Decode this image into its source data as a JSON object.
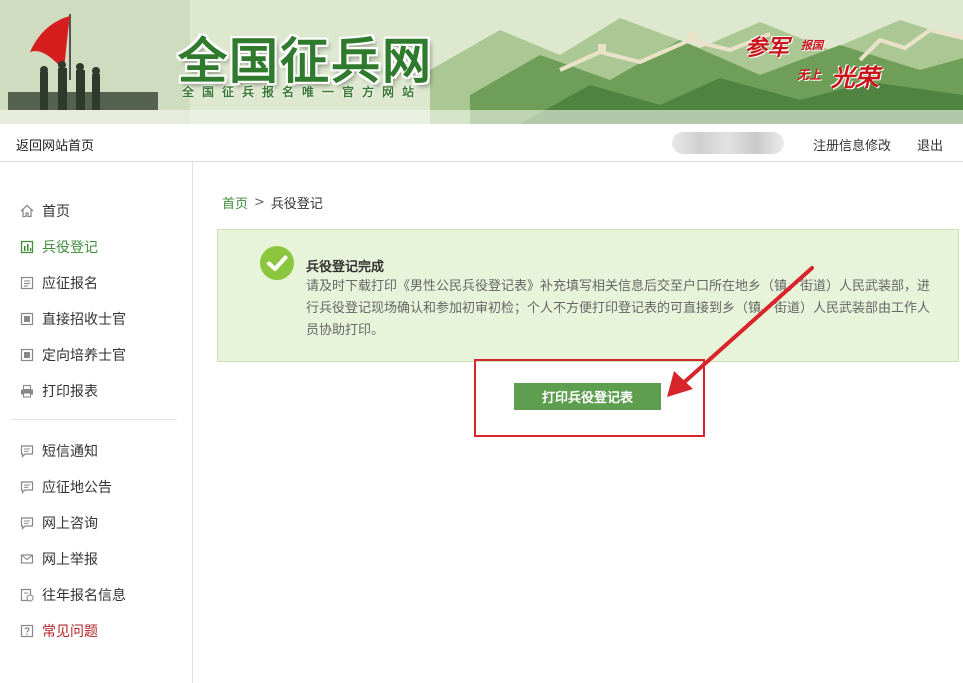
{
  "site": {
    "title": "全国征兵网",
    "subtitle": "全国征兵报名唯一官方网站"
  },
  "slogan": {
    "part1": "参军",
    "part2": "报国",
    "part3": "无上",
    "part4": "光荣"
  },
  "topnav": {
    "home_link": "返回网站首页",
    "profile_link": "注册信息修改",
    "logout_link": "退出"
  },
  "sidebar": {
    "items": [
      {
        "label": "首页",
        "icon": "home-icon"
      },
      {
        "label": "兵役登记",
        "icon": "register-icon",
        "active": true
      },
      {
        "label": "应征报名",
        "icon": "form-icon"
      },
      {
        "label": "直接招收士官",
        "icon": "form-icon"
      },
      {
        "label": "定向培养士官",
        "icon": "form-icon"
      },
      {
        "label": "打印报表",
        "icon": "printer-icon"
      },
      {
        "label": "短信通知",
        "icon": "message-icon"
      },
      {
        "label": "应征地公告",
        "icon": "message-icon"
      },
      {
        "label": "网上咨询",
        "icon": "message-icon"
      },
      {
        "label": "网上举报",
        "icon": "mail-icon"
      },
      {
        "label": "往年报名信息",
        "icon": "history-icon"
      },
      {
        "label": "常见问题",
        "icon": "question-icon"
      }
    ]
  },
  "breadcrumb": {
    "home": "首页",
    "separator": ">",
    "current": "兵役登记"
  },
  "notice": {
    "title": "兵役登记完成",
    "description": "请及时下载打印《男性公民兵役登记表》补充填写相关信息后交至户口所在地乡（镇、街道）人民武装部，进行兵役登记现场确认和参加初审初检；个人不方便打印登记表的可直接到乡（镇、街道）人民武装部由工作人员协助打印。"
  },
  "actions": {
    "print_button": "打印兵役登记表"
  },
  "colors": {
    "accent_green": "#3f8f3a",
    "button_green": "#5e9e4f",
    "notice_bg": "#e8f4d9",
    "highlight_red": "#d8252b",
    "faq_red": "#b3252a"
  }
}
